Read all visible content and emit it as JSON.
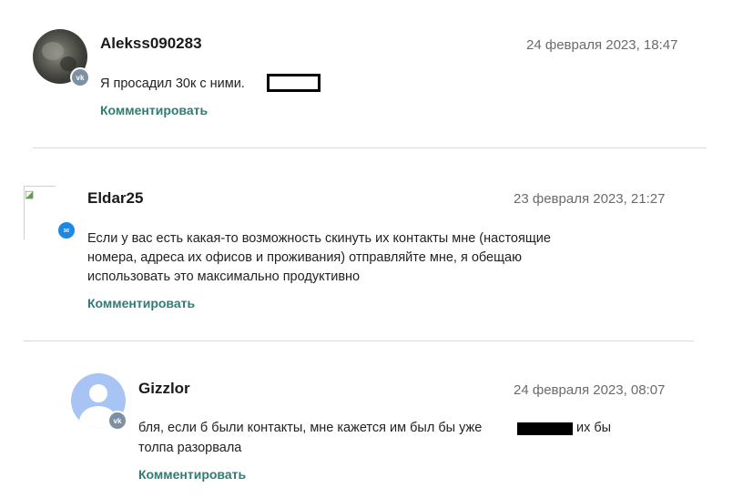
{
  "comments": [
    {
      "username": "Alekss090283",
      "date": "24 февраля 2023, 18:47",
      "text": "Я просадил 30к с ними.",
      "reply_label": "Комментировать",
      "source_icon": "vk-icon"
    },
    {
      "username": "Eldar25",
      "date": "23 февраля 2023, 21:27",
      "text_lines": [
        "Если у вас есть какая-то возможность скинуть их контакты мне (настоящие",
        "номера, адреса их офисов и проживания) отправляйте мне, я обещаю",
        "использовать это максимально продуктивно"
      ],
      "reply_label": "Комментировать",
      "source_icon": "mail-icon"
    },
    {
      "username": "Gizzlor",
      "date": "24 февраля 2023, 08:07",
      "text_line1_before": "бля, если б были контакты, мне кажется им был бы уже",
      "text_line1_after": "их бы",
      "text_line2": "толпа разорвала",
      "reply_label": "Комментировать",
      "source_icon": "vk-icon"
    }
  ],
  "colors": {
    "link": "#2e7d74",
    "date": "#6b6b6b",
    "divider": "#d9d9d9",
    "vk_badge": "#7d8fa3",
    "mail_badge": "#1e88e5",
    "default_avatar_bg": "#a7c4f5"
  }
}
